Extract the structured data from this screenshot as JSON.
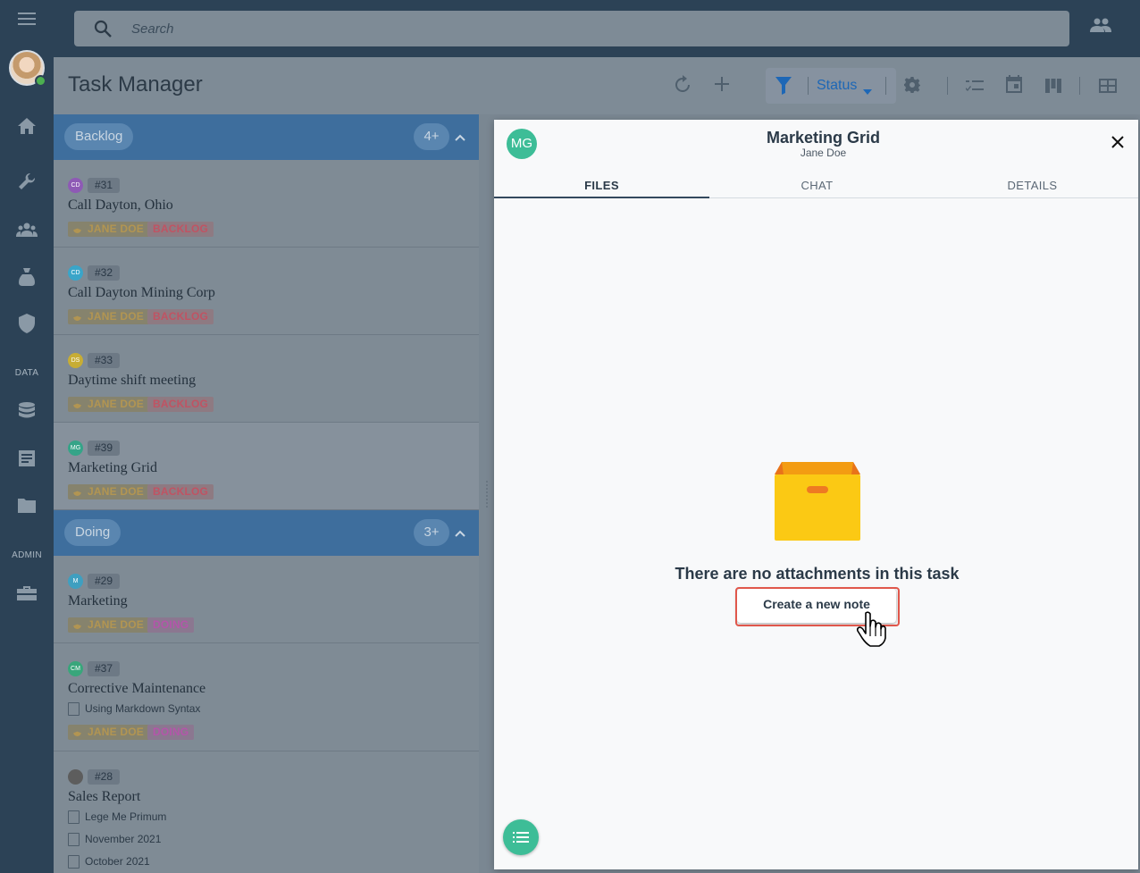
{
  "search": {
    "placeholder": "Search"
  },
  "rail": {
    "section_data": "DATA",
    "section_admin": "ADMIN"
  },
  "toolbar": {
    "title": "Task Manager",
    "filter_label": "Status"
  },
  "groups": [
    {
      "name": "Backlog",
      "count": "4+"
    },
    {
      "name": "Doing",
      "count": "3+"
    }
  ],
  "tasks": [
    {
      "initials": "CD",
      "number": "#31",
      "name": "Call Dayton, Ohio",
      "assignee": "JANE DOE",
      "status": "BACKLOG",
      "avatar_color": "#8e5ab5"
    },
    {
      "initials": "CD",
      "number": "#32",
      "name": "Call Dayton Mining Corp",
      "assignee": "JANE DOE",
      "status": "BACKLOG",
      "avatar_color": "#3aa5c9"
    },
    {
      "initials": "DS",
      "number": "#33",
      "name": "Daytime shift meeting",
      "assignee": "JANE DOE",
      "status": "BACKLOG",
      "avatar_color": "#c7ad35"
    },
    {
      "initials": "MG",
      "number": "#39",
      "name": "Marketing Grid",
      "assignee": "JANE DOE",
      "status": "BACKLOG",
      "avatar_color": "#35a488"
    },
    {
      "initials": "M",
      "number": "#29",
      "name": "Marketing",
      "assignee": "JANE DOE",
      "status": "DOING",
      "avatar_color": "#3f9fc0"
    },
    {
      "initials": "CM",
      "number": "#37",
      "name": "Corrective Maintenance",
      "doc": "Using Markdown Syntax",
      "assignee": "JANE DOE",
      "status": "DOING",
      "avatar_color": "#39a67b"
    },
    {
      "initials": "",
      "number": "#28",
      "name": "Sales Report",
      "docs": [
        "Lege Me Primum",
        "November 2021",
        "October 2021"
      ],
      "avatar_color": "#5d5d5d"
    }
  ],
  "panel": {
    "initials": "MG",
    "title": "Marketing Grid",
    "subtitle": "Jane Doe",
    "tabs": [
      "FILES",
      "CHAT",
      "DETAILS"
    ],
    "active_tab": "FILES",
    "empty_message": "There are no attachments in this task",
    "create_note_label": "Create a new note"
  },
  "colors": {
    "accent": "#3dbd97",
    "rail": "#2c4256",
    "group_header": "#3e6e9d"
  },
  "icons": [
    "menu-icon",
    "search-icon",
    "people-icon",
    "home-icon",
    "wrench-icon",
    "group-icon",
    "bag-icon",
    "shield-icon",
    "database-icon",
    "document-icon",
    "folder-icon",
    "toolbox-icon",
    "refresh-icon",
    "add-icon",
    "filter-icon",
    "gear-icon",
    "checklist-icon",
    "calendar-icon",
    "kanban-icon",
    "grid-icon",
    "close-icon",
    "box-icon",
    "list-icon",
    "hand-cursor-icon"
  ]
}
